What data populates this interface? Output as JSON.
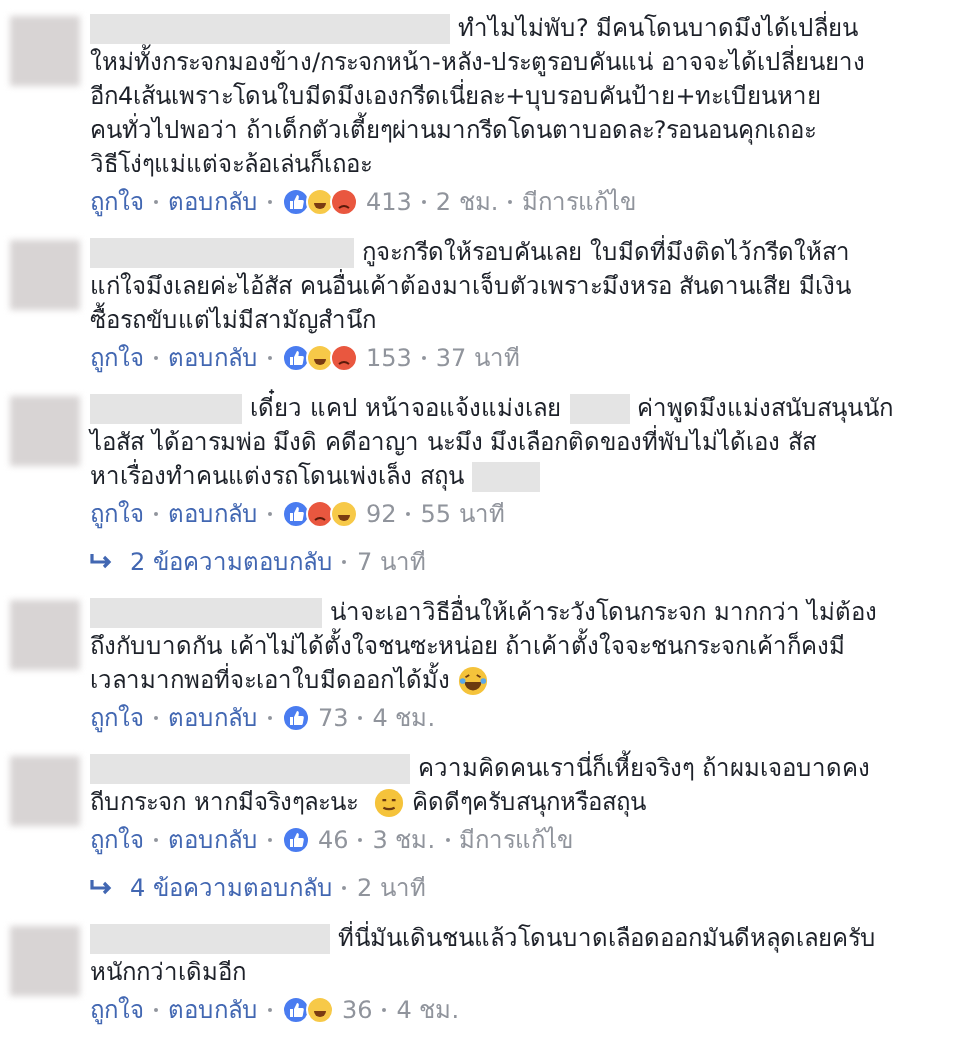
{
  "comments": [
    {
      "lines": [
        [
          {
            "kind": "redacted"
          },
          {
            "kind": "text",
            "text": "ทำไมไม่พับ? มีคนโดนบาดมึงได้เปลี่ยน"
          }
        ],
        [
          {
            "kind": "text",
            "text": "ใหม่ทั้งกระจกมองข้าง/กระจกหน้า-หลัง-ประตูรอบคันแน่ อาจจะได้เปลี่ยนยาง"
          }
        ],
        [
          {
            "kind": "text",
            "text": "อีก4เส้นเพราะโดนใบมีดมึงเองกรีดเนี่ยละ+บุบรอบคันป้าย+ทะเบียนหาย"
          }
        ],
        [
          {
            "kind": "text",
            "text": "คนทั่วไปพอว่า ถ้าเด็กตัวเตี้ยๆผ่านมากรีดโดนตาบอดละ?รอนอนคุกเถอะ"
          }
        ],
        [
          {
            "kind": "text",
            "text": "วิธีโง่ๆแม่แต่จะล้อเล่นก็เถอะ"
          }
        ]
      ],
      "like": "ถูกใจ",
      "reply": "ตอบกลับ",
      "reactions": [
        {
          "kind": "like"
        },
        {
          "kind": "haha"
        },
        {
          "kind": "angry"
        }
      ],
      "count": "413",
      "time": "2 ชม.",
      "edited": "มีการแก้ไข"
    },
    {
      "lines": [
        [
          {
            "kind": "redacted"
          },
          {
            "kind": "text",
            "text": "กูจะกรีดให้รอบคันเลย ใบมีดที่มึงติดไว้กรีดให้สา"
          }
        ],
        [
          {
            "kind": "text",
            "text": "แก่ใจมึงเลยค่ะไอ้สัส คนอื่นเค้าต้องมาเจ็บตัวเพราะมึงหรอ สันดานเสีย มีเงิน"
          }
        ],
        [
          {
            "kind": "text",
            "text": "ซื้อรถขับแต่ไม่มีสามัญสำนึก"
          }
        ]
      ],
      "like": "ถูกใจ",
      "reply": "ตอบกลับ",
      "reactions": [
        {
          "kind": "like"
        },
        {
          "kind": "haha"
        },
        {
          "kind": "angry"
        }
      ],
      "count": "153",
      "time": "37 นาที"
    },
    {
      "lines": [
        [
          {
            "kind": "redacted"
          },
          {
            "kind": "text",
            "text": "เดี๋ยว แคป หน้าจอแจ้งแม่งเลย"
          },
          {
            "kind": "redacted"
          },
          {
            "kind": "text",
            "text": "ค่าพูดมึงแม่งสนับสนุนนัก"
          }
        ],
        [
          {
            "kind": "text",
            "text": "ไอสัส ได้อารมพ่อ มึงดิ คดีอาญา นะมึง มึงเลือกติดของที่พับไม่ได้เอง สัส"
          }
        ],
        [
          {
            "kind": "text",
            "text": "หาเรื่องทำคนแต่งรถโดนเพ่งเล็ง สถุน"
          },
          {
            "kind": "redacted"
          }
        ]
      ],
      "like": "ถูกใจ",
      "reply": "ตอบกลับ",
      "reactions": [
        {
          "kind": "like"
        },
        {
          "kind": "angry"
        },
        {
          "kind": "haha"
        }
      ],
      "count": "92",
      "time": "55 นาที",
      "replies": {
        "label": "2 ข้อความตอบกลับ",
        "time": "7 นาที"
      }
    },
    {
      "lines": [
        [
          {
            "kind": "redacted"
          },
          {
            "kind": "text",
            "text": "น่าจะเอาวิธีอื่นให้เค้าระวังโดนกระจก มากกว่า ไม่ต้อง"
          }
        ],
        [
          {
            "kind": "text",
            "text": "ถึงกับบาดกัน เค้าไม่ได้ตั้งใจชนซะหน่อย ถ้าเค้าตั้งใจจะชนกระจกเค้าก็คงมี"
          }
        ],
        [
          {
            "kind": "text",
            "text": "เวลามากพอที่จะเอาใบมีดออกได้มั้ง"
          },
          {
            "kind": "laugh"
          }
        ]
      ],
      "like": "ถูกใจ",
      "reply": "ตอบกลับ",
      "reactions": [
        {
          "kind": "like"
        }
      ],
      "count": "73",
      "time": "4 ชม."
    },
    {
      "lines": [
        [
          {
            "kind": "redacted"
          },
          {
            "kind": "text",
            "text": "ความคิดคนเรานี่ก็เหี้ยจริงๆ ถ้าผมเจอบาดคง"
          }
        ],
        [
          {
            "kind": "text",
            "text": "ถีบกระจก หากมีจริงๆละนะ"
          },
          {
            "kind": "meh"
          },
          {
            "kind": "text",
            "text": "คิดดีๆครับสนุกหรือสถุน"
          }
        ]
      ],
      "like": "ถูกใจ",
      "reply": "ตอบกลับ",
      "reactions": [
        {
          "kind": "like"
        }
      ],
      "count": "46",
      "time": "3 ชม.",
      "edited": "มีการแก้ไข",
      "replies": {
        "label": "4 ข้อความตอบกลับ",
        "time": "2 นาที"
      }
    },
    {
      "lines": [
        [
          {
            "kind": "redacted"
          },
          {
            "kind": "text",
            "text": "ที่นี่มันเดินชนแล้วโดนบาดเลือดออกมันดีหลุดเลยครับ"
          }
        ],
        [
          {
            "kind": "text",
            "text": "หนักกว่าเดิมอีก"
          }
        ]
      ],
      "like": "ถูกใจ",
      "reply": "ตอบกลับ",
      "reactions": [
        {
          "kind": "like"
        },
        {
          "kind": "haha"
        }
      ],
      "count": "36",
      "time": "4 ชม."
    }
  ]
}
